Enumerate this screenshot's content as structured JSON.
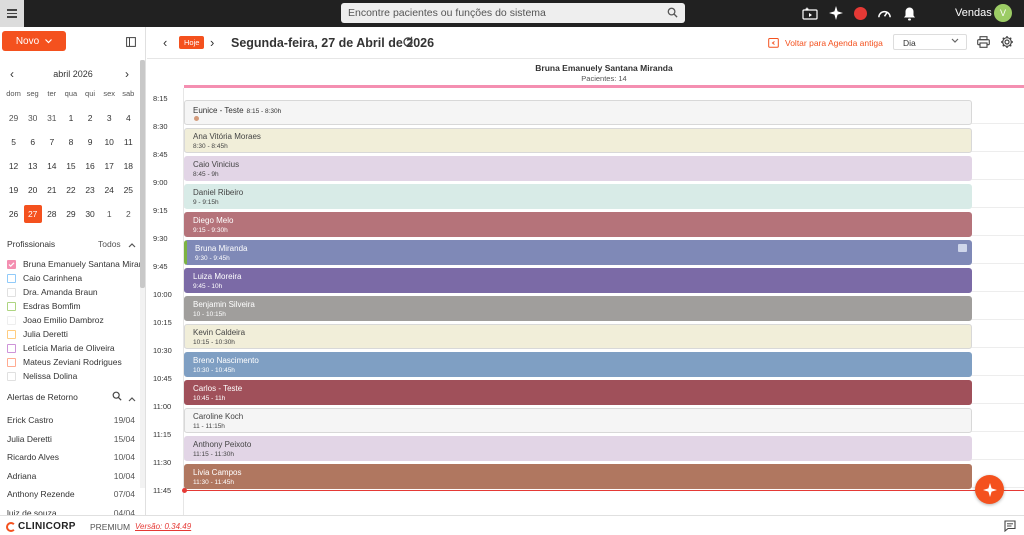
{
  "topbar": {
    "search_placeholder": "Encontre pacientes ou funções do sistema",
    "username": "Vendas",
    "avatar_initial": "V"
  },
  "sidebar": {
    "new_button_label": "Novo",
    "calendar": {
      "month_label": "abril 2026",
      "weekdays": [
        "dom",
        "seg",
        "ter",
        "qua",
        "qui",
        "sex",
        "sab"
      ],
      "days": [
        {
          "n": "29",
          "muted": true
        },
        {
          "n": "30",
          "muted": true
        },
        {
          "n": "31",
          "muted": true
        },
        {
          "n": "1"
        },
        {
          "n": "2"
        },
        {
          "n": "3"
        },
        {
          "n": "4"
        },
        {
          "n": "5"
        },
        {
          "n": "6"
        },
        {
          "n": "7"
        },
        {
          "n": "8"
        },
        {
          "n": "9"
        },
        {
          "n": "10"
        },
        {
          "n": "11"
        },
        {
          "n": "12"
        },
        {
          "n": "13"
        },
        {
          "n": "14"
        },
        {
          "n": "15"
        },
        {
          "n": "16"
        },
        {
          "n": "17"
        },
        {
          "n": "18"
        },
        {
          "n": "19"
        },
        {
          "n": "20"
        },
        {
          "n": "21"
        },
        {
          "n": "22"
        },
        {
          "n": "23"
        },
        {
          "n": "24"
        },
        {
          "n": "25"
        },
        {
          "n": "26"
        },
        {
          "n": "27",
          "selected": true
        },
        {
          "n": "28"
        },
        {
          "n": "29"
        },
        {
          "n": "30"
        },
        {
          "n": "1",
          "muted": true
        },
        {
          "n": "2",
          "muted": true
        }
      ]
    },
    "professionals_title": "Profissionais",
    "professionals_all": "Todos",
    "professionals": [
      {
        "name": "Bruna Emanuely Santana Miranda",
        "color": "#f48fb1",
        "checked": true
      },
      {
        "name": "Caio Carinhena",
        "color": "#90caf9"
      },
      {
        "name": "Dra. Amanda Braun",
        "color": "#e0e0e0"
      },
      {
        "name": "Esdras Bomfim",
        "color": "#aed581"
      },
      {
        "name": "Joao Emilio Dambroz",
        "color": "#eeeeee"
      },
      {
        "name": "Julia Deretti",
        "color": "#ffcc80"
      },
      {
        "name": "Letícia Maria de Oliveira",
        "color": "#ce93d8"
      },
      {
        "name": "Mateus Zeviani Rodrigues",
        "color": "#ffab91"
      },
      {
        "name": "Nelissa Dolina",
        "color": "#e0e0e0"
      }
    ],
    "alerts_title": "Alertas de Retorno",
    "alerts": [
      {
        "name": "Erick Castro",
        "date": "19/04"
      },
      {
        "name": "Julia Deretti",
        "date": "15/04"
      },
      {
        "name": "Ricardo Alves",
        "date": "10/04"
      },
      {
        "name": "Adriana",
        "date": "10/04"
      },
      {
        "name": "Anthony Rezende",
        "date": "07/04"
      },
      {
        "name": "luiz de souza",
        "date": "04/04"
      }
    ]
  },
  "main": {
    "today_label": "Hoje",
    "date_title": "Segunda-feira, 27 de Abril de 2026",
    "back_link": "Voltar para Agenda antiga",
    "view_selected": "Dia",
    "column": {
      "name": "Bruna Emanuely Santana Miranda",
      "subtitle": "Pacientes: 14",
      "accent": "#f48fb1"
    },
    "time_labels": [
      "8:15",
      "8:30",
      "8:45",
      "9:00",
      "9:15",
      "9:30",
      "9:45",
      "10:00",
      "10:15",
      "10:30",
      "10:45",
      "11:00",
      "11:15",
      "11:30",
      "11:45"
    ],
    "appointments": [
      {
        "name": "Eunice - Teste",
        "time": "8:15 - 8:30h",
        "bg": "#f5f5f5",
        "fg": "#333333",
        "inline": true,
        "dot": true
      },
      {
        "name": "Ana Vitória Moraes",
        "time": "8:30 - 8:45h",
        "bg": "#f1eed9",
        "fg": "#444444"
      },
      {
        "name": "Caio Vinicius",
        "time": "8:45 - 9h",
        "bg": "#e2d5e6",
        "fg": "#444444"
      },
      {
        "name": "Daniel Ribeiro",
        "time": "9 - 9:15h",
        "bg": "#d8ebe7",
        "fg": "#444444"
      },
      {
        "name": "Diego Melo",
        "time": "9:15 - 9:30h",
        "bg": "#b5737a",
        "fg": "#ffffff"
      },
      {
        "name": "Bruna Miranda",
        "time": "9:30 - 9:45h",
        "bg": "#7f89b7",
        "fg": "#ffffff",
        "badge": true,
        "leftborder": "#7cb342"
      },
      {
        "name": "Luiza Moreira",
        "time": "9:45 - 10h",
        "bg": "#7b6aa6",
        "fg": "#ffffff"
      },
      {
        "name": "Benjamin Silveira",
        "time": "10 - 10:15h",
        "bg": "#a09e9c",
        "fg": "#ffffff"
      },
      {
        "name": "Kevin Caldeira",
        "time": "10:15 - 10:30h",
        "bg": "#f1eed9",
        "fg": "#444444"
      },
      {
        "name": "Breno Nascimento",
        "time": "10:30 - 10:45h",
        "bg": "#7f9fc3",
        "fg": "#ffffff"
      },
      {
        "name": "Carlos - Teste",
        "time": "10:45 - 11h",
        "bg": "#a0505a",
        "fg": "#ffffff"
      },
      {
        "name": "Caroline Koch",
        "time": "11 - 11:15h",
        "bg": "#f5f5f5",
        "fg": "#444444"
      },
      {
        "name": "Anthony Peixoto",
        "time": "11:15 - 11:30h",
        "bg": "#e2d5e6",
        "fg": "#444444"
      },
      {
        "name": "Livia Campos",
        "time": "11:30 - 11:45h",
        "bg": "#b07760",
        "fg": "#ffffff"
      }
    ]
  },
  "footer": {
    "brand": "CLINICORP",
    "plan": "PREMIUM",
    "version": "Versão: 0.34.49"
  }
}
